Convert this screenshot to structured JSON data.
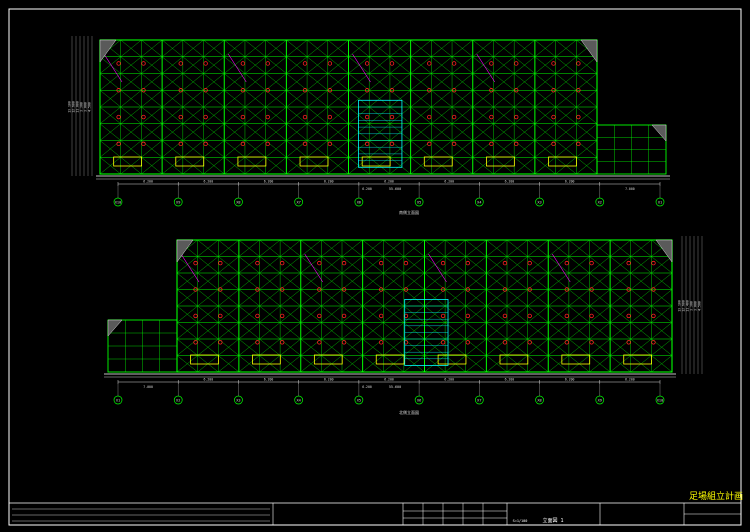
{
  "colors": {
    "background": "#000000",
    "frame": "#ffffff",
    "green": "#00ff00",
    "cyan": "#00ffff",
    "yellow": "#ffff00",
    "red": "#ff2020",
    "magenta": "#ff00ff",
    "dims": "#d8d8d8"
  },
  "title_block": {
    "drawing_title": "足場組立計画",
    "drawing_name": "立面図 1",
    "scale": "S=1/100"
  },
  "elevation_top": {
    "caption": "南側立面図",
    "grid_labels": [
      "X10",
      "X9",
      "X8",
      "X7",
      "X6",
      "X5",
      "X4",
      "X3",
      "X2",
      "X1"
    ],
    "bay_dims": [
      "6.200",
      "6.200",
      "6.200",
      "6.200",
      "6.200",
      "6.200",
      "6.200",
      "6.200"
    ],
    "overall_dim": "55.600",
    "end_dim": "7.000",
    "center_dim": "6.200",
    "height_dims": [
      "13.100",
      "12.600",
      "11.000",
      "3.300",
      "3.000",
      "4.500"
    ]
  },
  "elevation_bottom": {
    "caption": "北側立面図",
    "grid_labels": [
      "X1",
      "X2",
      "X3",
      "X4",
      "X5",
      "X6",
      "X7",
      "X8",
      "X9",
      "X10"
    ],
    "bay_dims": [
      "6.200",
      "6.200",
      "6.200",
      "6.200",
      "6.200",
      "6.200",
      "6.200",
      "6.200"
    ],
    "overall_dim": "55.600",
    "end_dim": "7.000",
    "center_dim": "6.200",
    "height_dims": [
      "13.100",
      "12.600",
      "11.400",
      "3.300",
      "3.000",
      "4.500"
    ]
  }
}
